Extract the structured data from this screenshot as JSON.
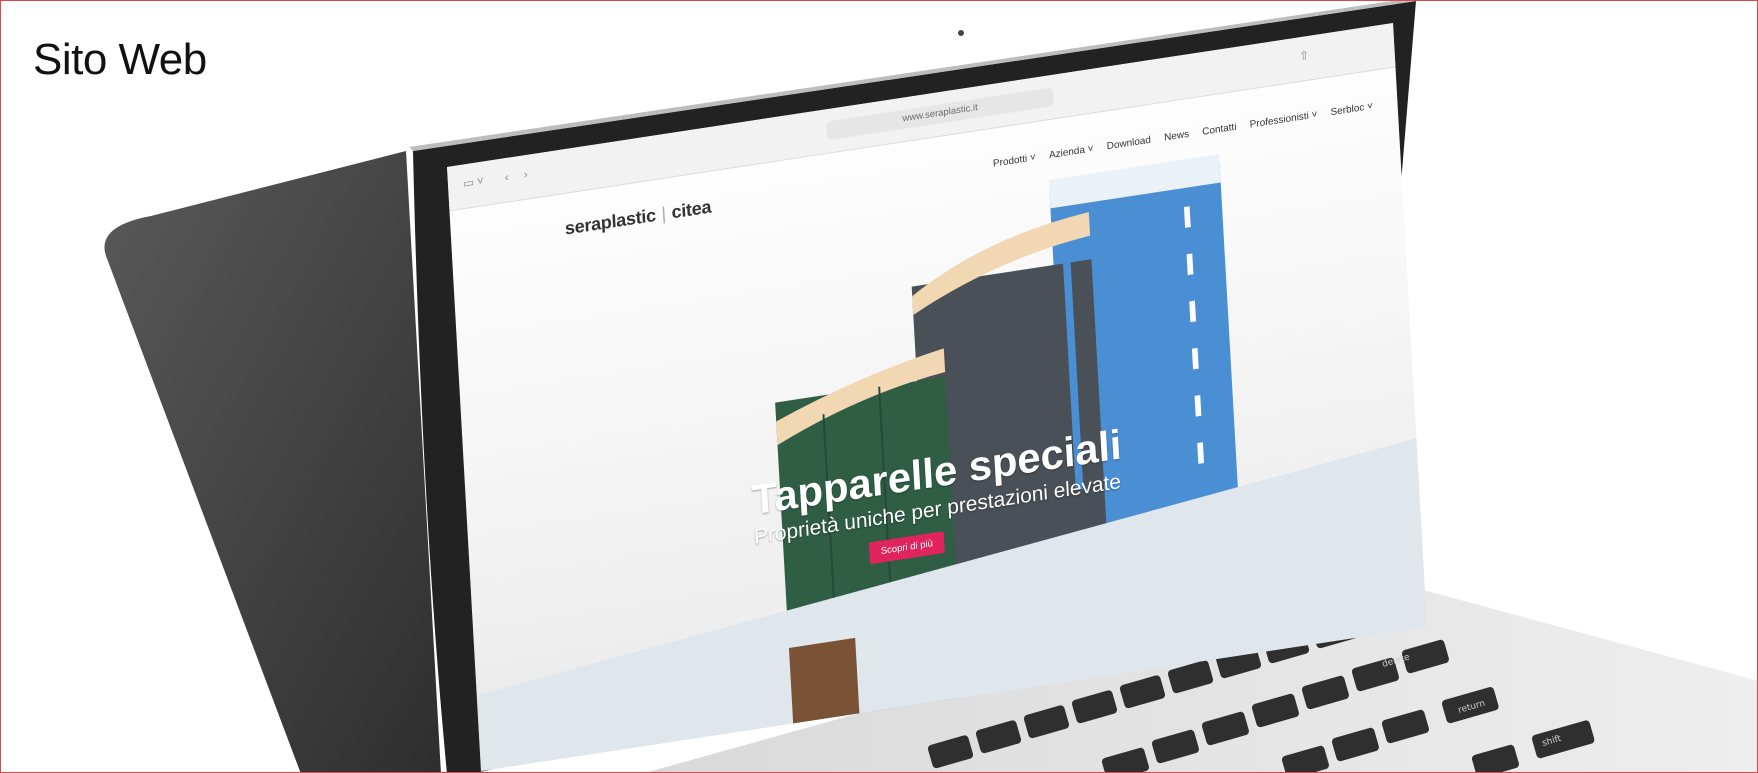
{
  "page": {
    "title": "Sito Web"
  },
  "browser": {
    "url": "www.seraplastic.it"
  },
  "site": {
    "logo_left": "seraplastic",
    "logo_separator": "|",
    "logo_right": "citea",
    "nav": [
      "Prodotti ˅",
      "Azienda ˅",
      "Download",
      "News",
      "Contatti",
      "Professionisti ˅",
      "Serbloc ˅"
    ]
  },
  "hero": {
    "title": "Tapparelle speciali",
    "subtitle": "Proprietà uniche per prestazioni elevate",
    "cta": "Scopri di più"
  },
  "keyboard": {
    "keys": [
      "delete",
      "return",
      "shift"
    ]
  },
  "colors": {
    "accent": "#e0245e",
    "blue_shutter": "#4a8fd4",
    "green_shutter": "#2f5e45",
    "dark_shutter": "#4a5058"
  }
}
